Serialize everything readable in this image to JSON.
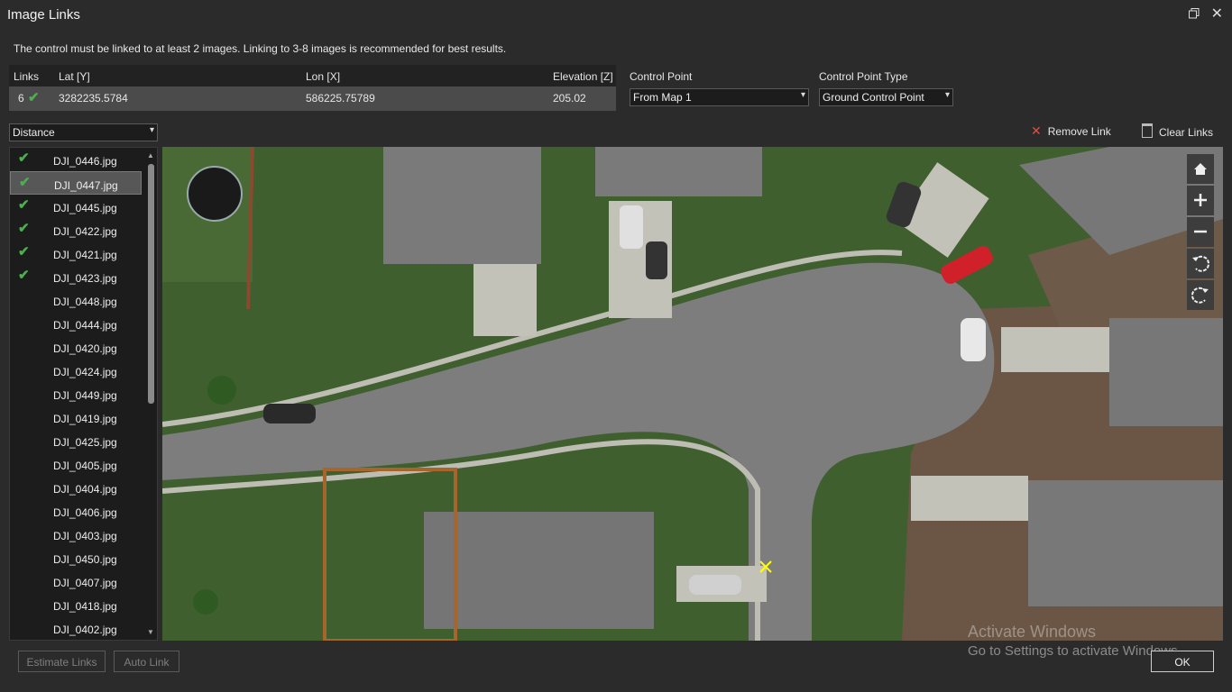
{
  "window": {
    "title": "Image Links"
  },
  "info_text": "The control must be linked to at least 2 images. Linking to 3-8 images is recommended for best results.",
  "links_table": {
    "headers": [
      "Links",
      "Lat [Y]",
      "Lon [X]",
      "Elevation [Z]"
    ],
    "row": {
      "links": "6",
      "lat": "3282235.5784",
      "lon": "586225.75789",
      "elevation": "205.02"
    }
  },
  "control_point": {
    "label": "Control Point",
    "value": "From Map 1"
  },
  "control_point_type": {
    "label": "Control Point Type",
    "value": "Ground Control Point"
  },
  "sort_select": {
    "value": "Distance"
  },
  "actions": {
    "remove_link": "Remove Link",
    "clear_links": "Clear Links"
  },
  "images": [
    {
      "name": "DJI_0446.jpg",
      "linked": true,
      "selected": false
    },
    {
      "name": "DJI_0447.jpg",
      "linked": true,
      "selected": true
    },
    {
      "name": "DJI_0445.jpg",
      "linked": true,
      "selected": false
    },
    {
      "name": "DJI_0422.jpg",
      "linked": true,
      "selected": false
    },
    {
      "name": "DJI_0421.jpg",
      "linked": true,
      "selected": false
    },
    {
      "name": "DJI_0423.jpg",
      "linked": true,
      "selected": false
    },
    {
      "name": "DJI_0448.jpg",
      "linked": false,
      "selected": false
    },
    {
      "name": "DJI_0444.jpg",
      "linked": false,
      "selected": false
    },
    {
      "name": "DJI_0420.jpg",
      "linked": false,
      "selected": false
    },
    {
      "name": "DJI_0424.jpg",
      "linked": false,
      "selected": false
    },
    {
      "name": "DJI_0449.jpg",
      "linked": false,
      "selected": false
    },
    {
      "name": "DJI_0419.jpg",
      "linked": false,
      "selected": false
    },
    {
      "name": "DJI_0425.jpg",
      "linked": false,
      "selected": false
    },
    {
      "name": "DJI_0405.jpg",
      "linked": false,
      "selected": false
    },
    {
      "name": "DJI_0404.jpg",
      "linked": false,
      "selected": false
    },
    {
      "name": "DJI_0406.jpg",
      "linked": false,
      "selected": false
    },
    {
      "name": "DJI_0403.jpg",
      "linked": false,
      "selected": false
    },
    {
      "name": "DJI_0450.jpg",
      "linked": false,
      "selected": false
    },
    {
      "name": "DJI_0407.jpg",
      "linked": false,
      "selected": false
    },
    {
      "name": "DJI_0418.jpg",
      "linked": false,
      "selected": false
    },
    {
      "name": "DJI_0402.jpg",
      "linked": false,
      "selected": false
    }
  ],
  "nav_tools": [
    "home-icon",
    "zoom-in-icon",
    "zoom-out-icon",
    "rotate-left-icon",
    "rotate-right-icon"
  ],
  "buttons": {
    "estimate_links": "Estimate Links",
    "auto_link": "Auto Link",
    "ok": "OK"
  },
  "watermark": {
    "line1": "Activate Windows",
    "line2": "Go to Settings to activate Windows."
  },
  "colors": {
    "check": "#4caf50",
    "remove": "#e74c3c",
    "control_point_marker": "#ffff00"
  }
}
